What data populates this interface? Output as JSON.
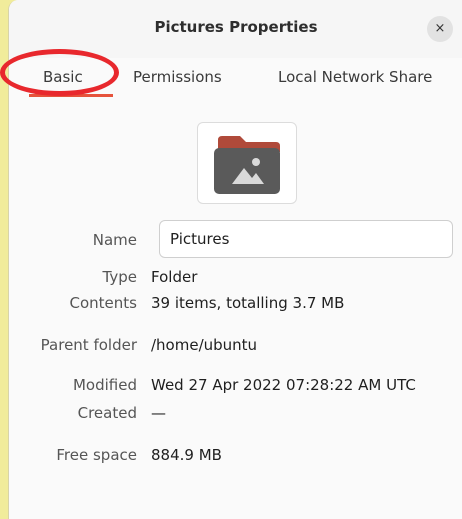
{
  "window": {
    "title": "Pictures Properties",
    "close_glyph": "×"
  },
  "tabs": [
    {
      "label": "Basic",
      "active": true
    },
    {
      "label": "Permissions",
      "active": false
    },
    {
      "label": "Local Network Share",
      "active": false
    }
  ],
  "icon": {
    "name": "folder-pictures-icon",
    "body_color": "#5a5a5a",
    "tab_color": "#b04a3a"
  },
  "fields": {
    "name": {
      "label": "Name",
      "value": "Pictures"
    },
    "type": {
      "label": "Type",
      "value": "Folder"
    },
    "contents": {
      "label": "Contents",
      "value": "39 items, totalling 3.7 MB"
    },
    "parent": {
      "label": "Parent folder",
      "value": "/home/ubuntu"
    },
    "modified": {
      "label": "Modified",
      "value": "Wed 27 Apr 2022 07:28:22 AM UTC"
    },
    "created": {
      "label": "Created",
      "value": "—"
    },
    "free_space": {
      "label": "Free space",
      "value": "884.9 MB"
    }
  },
  "colors": {
    "accent": "#e6533c",
    "annotation": "#e8282d",
    "background": "#f1ec9b"
  }
}
